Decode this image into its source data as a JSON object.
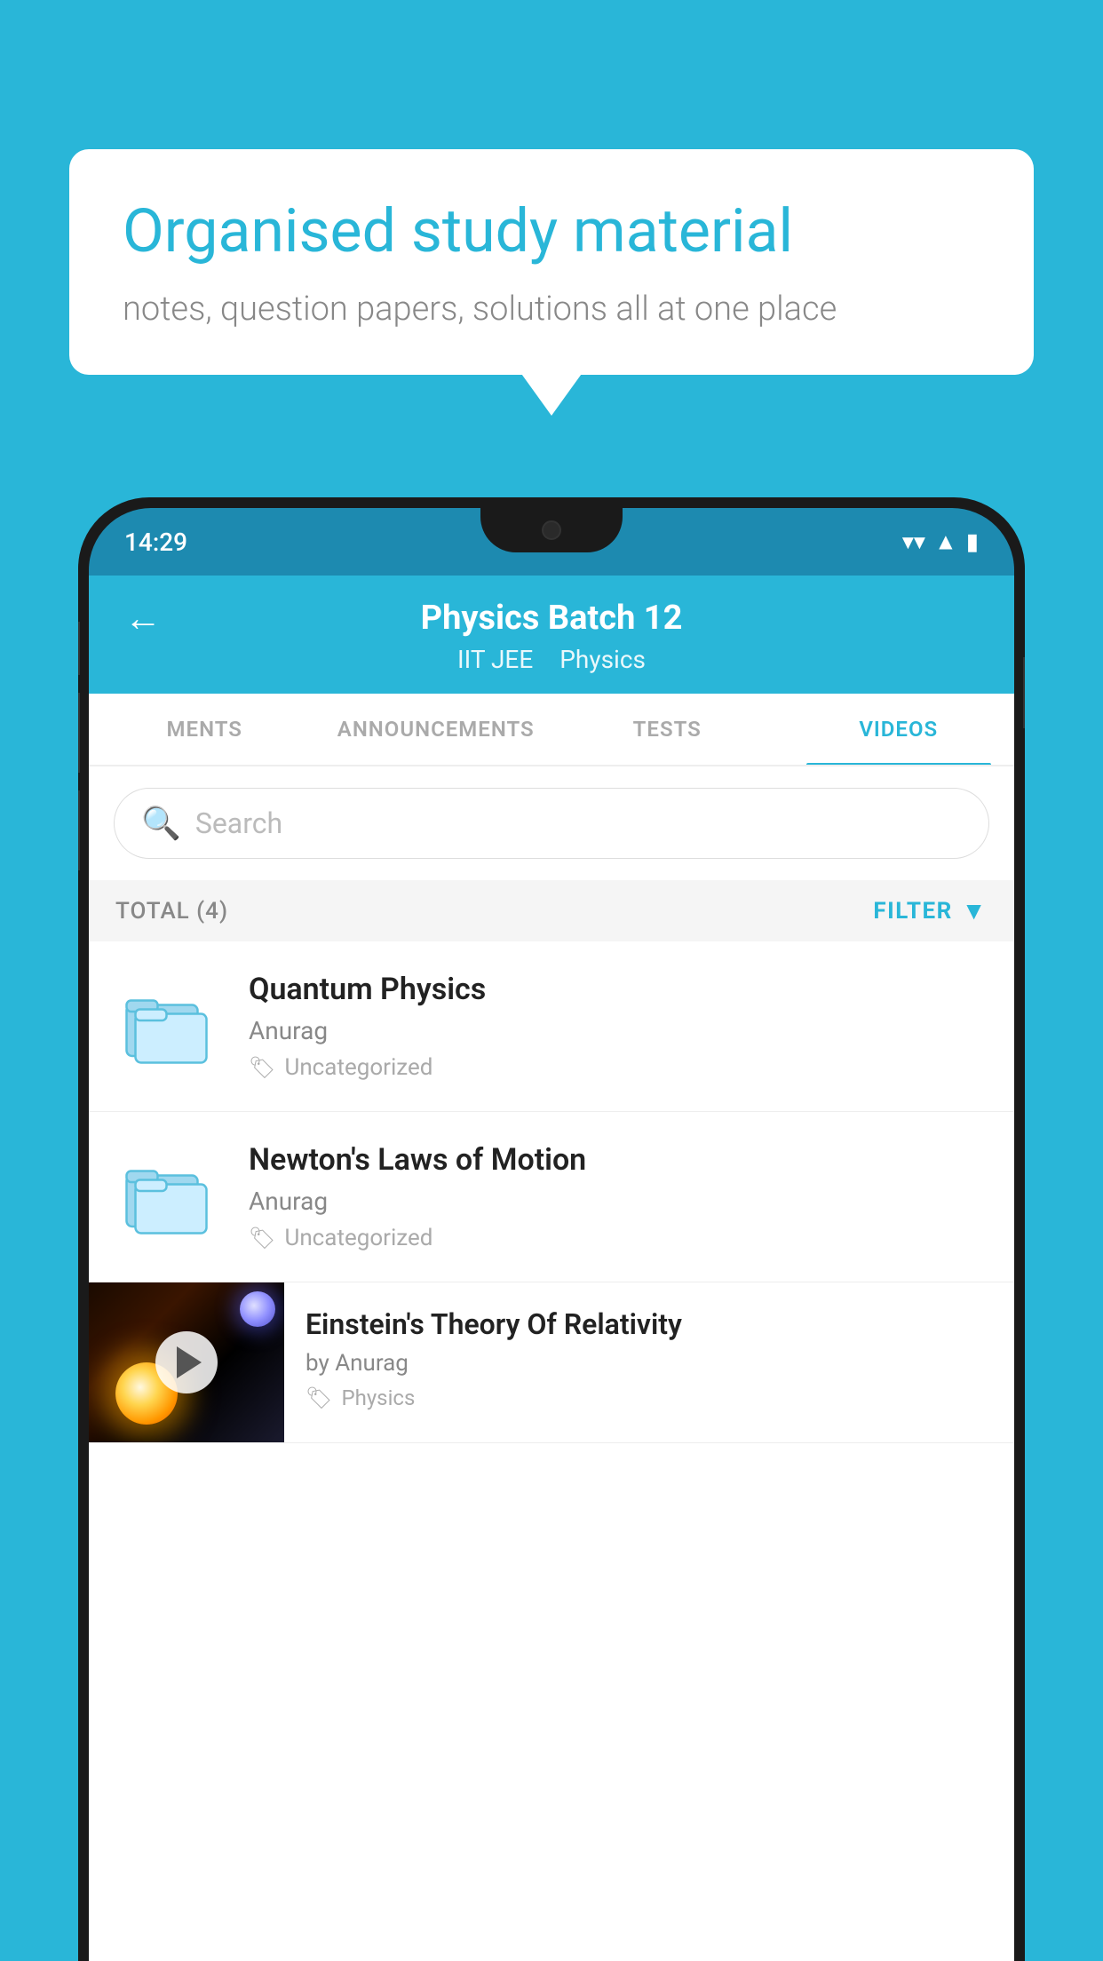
{
  "background_color": "#29B6D8",
  "speech_bubble": {
    "headline": "Organised study material",
    "subtext": "notes, question papers, solutions all at one place"
  },
  "status_bar": {
    "time": "14:29"
  },
  "app_header": {
    "title": "Physics Batch 12",
    "tag1": "IIT JEE",
    "tag2": "Physics",
    "back_label": "←"
  },
  "tabs": [
    {
      "label": "MENTS",
      "active": false
    },
    {
      "label": "ANNOUNCEMENTS",
      "active": false
    },
    {
      "label": "TESTS",
      "active": false
    },
    {
      "label": "VIDEOS",
      "active": true
    }
  ],
  "search": {
    "placeholder": "Search"
  },
  "filter_row": {
    "total": "TOTAL (4)",
    "filter_label": "FILTER"
  },
  "videos": [
    {
      "title": "Quantum Physics",
      "author": "Anurag",
      "category": "Uncategorized",
      "has_thumb": false
    },
    {
      "title": "Newton's Laws of Motion",
      "author": "Anurag",
      "category": "Uncategorized",
      "has_thumb": false
    },
    {
      "title": "Einstein's Theory Of Relativity",
      "author": "by Anurag",
      "category": "Physics",
      "has_thumb": true
    }
  ]
}
